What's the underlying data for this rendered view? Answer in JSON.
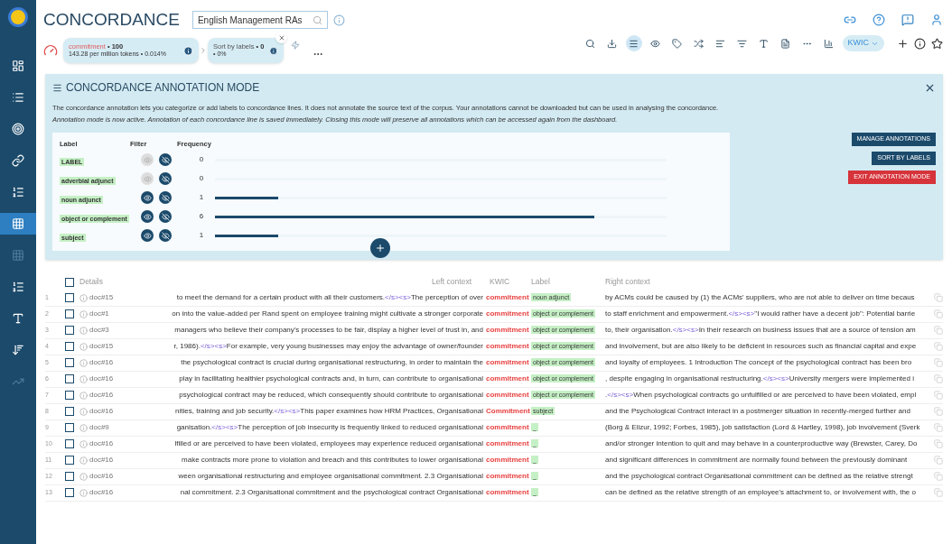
{
  "header": {
    "title": "CONCORDANCE",
    "corpus": "English Management RAs"
  },
  "select_all_checked": false,
  "chips": [
    {
      "query": "commitment",
      "count": "• 100",
      "detail": "143.28 per million tokens • 0.014%",
      "closable": false
    },
    {
      "query": "Sort by labels",
      "count": "• 0",
      "detail": "• 0%",
      "closable": true
    }
  ],
  "toolbar": [
    {
      "kind": "search",
      "selected": false
    },
    {
      "kind": "download",
      "selected": false
    },
    {
      "kind": "lines",
      "selected": true
    },
    {
      "kind": "eye",
      "selected": false
    },
    {
      "kind": "tag",
      "selected": false
    },
    {
      "kind": "shuffle",
      "selected": false
    },
    {
      "kind": "sort",
      "selected": false
    },
    {
      "kind": "filter",
      "selected": false
    },
    {
      "kind": "gdex",
      "selected": false
    },
    {
      "kind": "doc",
      "selected": false
    },
    {
      "kind": "dots",
      "selected": false
    },
    {
      "kind": "chart",
      "selected": false
    }
  ],
  "view_select": "KWIC",
  "sidebar": [
    {
      "kind": "dashboard",
      "selected": false
    },
    {
      "kind": "list",
      "selected": false
    },
    {
      "kind": "target",
      "selected": false
    },
    {
      "kind": "chain",
      "selected": false
    },
    {
      "kind": "bullets",
      "selected": false
    },
    {
      "kind": "concordance",
      "selected": true
    },
    {
      "kind": "grid",
      "selected": false
    },
    {
      "kind": "rank",
      "selected": false
    },
    {
      "kind": "ne",
      "selected": false
    },
    {
      "kind": "sort",
      "selected": false
    },
    {
      "kind": "trend",
      "selected": false
    }
  ],
  "annotation": {
    "title": "CONCORDANCE ANNOTATION MODE",
    "description": "The concordance annotation lets you categorize or add labels to concordance lines. It does not annotate the source text of the corpus. Your annotations cannot be downloaded but can be used in analysing the concordance.",
    "note": "Annotation mode is now active. Annotation of each concordance line is saved immediately. Closing this mode will preserve all annotations which can be accessed again from the dashboard.",
    "columns": [
      "Label",
      "Filter",
      "Frequency"
    ],
    "labels": [
      {
        "label": "LABEL",
        "visible_enabled": false,
        "frequency": "0"
      },
      {
        "label": "adverbial adjunct",
        "visible_enabled": false,
        "frequency": "0"
      },
      {
        "label": "noun adjunct",
        "visible_enabled": true,
        "frequency": "1",
        "level": 0.14
      },
      {
        "label": "object or complement",
        "visible_enabled": true,
        "frequency": "6",
        "level": 0.84
      },
      {
        "label": "subject",
        "visible_enabled": true,
        "frequency": "1",
        "level": 0.14
      }
    ],
    "buttons": [
      {
        "label": "MANAGE ANNOTATIONS",
        "kind": "primary"
      },
      {
        "label": "SORT BY LABELS",
        "kind": "primary"
      },
      {
        "label": "EXIT ANNOTATION MODE",
        "kind": "danger"
      }
    ]
  },
  "table": {
    "columns": [
      "Details",
      "Left context",
      "KWIC",
      "Label",
      "Right context"
    ],
    "rows": [
      {
        "num": "1",
        "checked": false,
        "doc": "doc#15",
        "left": [
          {
            "kind": "text",
            "text": "to meet the demand for a certain product with all their customers."
          },
          {
            "kind": "tag",
            "text": "</s><s>"
          },
          {
            "kind": "text",
            "text": "The perception of over"
          }
        ],
        "kwic": "commitment",
        "label": "noun adjunct",
        "right": [
          {
            "kind": "text",
            "text": "by ACMs could be caused by (1) the ACMs' suppliers, who are not able to deliver on time becaus"
          }
        ]
      },
      {
        "num": "2",
        "checked": false,
        "doc": "doc#1",
        "left": [
          {
            "kind": "text",
            "text": "on into the value-added per Rand spent on employee training might cultivate a stronger corporate"
          }
        ],
        "kwic": "commitment",
        "label": "object or complement",
        "right": [
          {
            "kind": "text",
            "text": "to staff enrichment and empowerment."
          },
          {
            "kind": "tag",
            "text": "</s><s>"
          },
          {
            "kind": "text",
            "text": "\"I would rather have a decent job\": Potential barrie"
          }
        ]
      },
      {
        "num": "3",
        "checked": false,
        "doc": "doc#3",
        "left": [
          {
            "kind": "text",
            "text": "managers who believe their company's processes to be fair, display a higher level of trust in, and"
          }
        ],
        "kwic": "commitment",
        "label": "object or complement",
        "right": [
          {
            "kind": "text",
            "text": "to, their organisation."
          },
          {
            "kind": "tag",
            "text": "</s><s>"
          },
          {
            "kind": "text",
            "text": "In their research on business issues that are a source of tension am"
          }
        ]
      },
      {
        "num": "4",
        "checked": false,
        "doc": "doc#15",
        "left": [
          {
            "kind": "text",
            "text": "r, 1986)."
          },
          {
            "kind": "tag",
            "text": "</s><s>"
          },
          {
            "kind": "text",
            "text": "For example, very young businesses may enjoy the advantage of owner/founder"
          }
        ],
        "kwic": "commitment",
        "label": "object or complement",
        "right": [
          {
            "kind": "text",
            "text": "and involvement, but are also likely to be deficient in resources such as financial capital and expe"
          }
        ]
      },
      {
        "num": "5",
        "checked": false,
        "doc": "doc#16",
        "left": [
          {
            "kind": "text",
            "text": "the psychological contract is crucial during organisational restructuring, in order to maintain the"
          }
        ],
        "kwic": "commitment",
        "label": "object or complement",
        "right": [
          {
            "kind": "text",
            "text": "and loyalty of employees. 1 Introduction The concept of the psychological contract has been bro"
          }
        ]
      },
      {
        "num": "6",
        "checked": false,
        "doc": "doc#16",
        "left": [
          {
            "kind": "text",
            "text": "play in facilitating healthier psychological contracts and, in turn, can contribute to organisational"
          }
        ],
        "kwic": "commitment",
        "label": "object or complement",
        "right": [
          {
            "kind": "text",
            "text": ", despite engaging in organisational restructuring."
          },
          {
            "kind": "tag",
            "text": "</s><s>"
          },
          {
            "kind": "text",
            "text": "University mergers were implemented i"
          }
        ]
      },
      {
        "num": "7",
        "checked": false,
        "doc": "doc#16",
        "left": [
          {
            "kind": "text",
            "text": "psychological contract may be reduced, which consequently should contribute to organisational"
          }
        ],
        "kwic": "commitment",
        "label": "object or complement",
        "right": [
          {
            "kind": "text",
            "text": "."
          },
          {
            "kind": "tag",
            "text": "</s><s>"
          },
          {
            "kind": "text",
            "text": "When psychological contracts go unfulfilled or are perceived to have been violated, empl"
          }
        ]
      },
      {
        "num": "8",
        "checked": false,
        "doc": "doc#16",
        "left": [
          {
            "kind": "text",
            "text": "nities, training and job security."
          },
          {
            "kind": "tag",
            "text": "</s><s>"
          },
          {
            "kind": "text",
            "text": "This paper examines how HRM Practices, Organisational"
          }
        ],
        "kwic": "Commitment",
        "label": "subject",
        "right": [
          {
            "kind": "text",
            "text": "and the Psychological Contract interact in a postmerger situation in recently-merged further and"
          }
        ]
      },
      {
        "num": "9",
        "checked": false,
        "doc": "doc#9",
        "left": [
          {
            "kind": "text",
            "text": "ganisation."
          },
          {
            "kind": "tag",
            "text": "</s><s>"
          },
          {
            "kind": "text",
            "text": "The perception of job insecurity is frequently linked to reduced organisational"
          }
        ],
        "kwic": "commitment",
        "label": "_",
        "right": [
          {
            "kind": "text",
            "text": "(Borg & Elizur, 1992; Forbes, 1985), job satisfaction (Lord & Hartley, 1998), job involvement (Sverk"
          }
        ]
      },
      {
        "num": "10",
        "checked": false,
        "doc": "doc#16",
        "left": [
          {
            "kind": "text",
            "text": "lfilled or are perceived to have been violated, employees may experience reduced organisational"
          }
        ],
        "kwic": "commitment",
        "label": "_",
        "right": [
          {
            "kind": "text",
            "text": "and/or stronger intention to quit and may behave in a counterproductive way (Brewster, Carey, Do"
          }
        ]
      },
      {
        "num": "11",
        "checked": false,
        "doc": "doc#16",
        "left": [
          {
            "kind": "text",
            "text": "make contracts more prone to violation and breach and this contributes to lower organisational"
          }
        ],
        "kwic": "commitment",
        "label": "_",
        "right": [
          {
            "kind": "text",
            "text": "and significant differences in commitment are normally found between the previously dominant"
          }
        ]
      },
      {
        "num": "12",
        "checked": false,
        "doc": "doc#16",
        "left": [
          {
            "kind": "text",
            "text": "ween organisational restructuring and employee organisational commitment. 2.3 Organisational"
          }
        ],
        "kwic": "commitment",
        "label": "_",
        "right": [
          {
            "kind": "text",
            "text": "and the psychological contract Organisational commitment can be defined as the relative strengt"
          }
        ]
      },
      {
        "num": "13",
        "checked": false,
        "doc": "doc#16",
        "left": [
          {
            "kind": "text",
            "text": "nal commitment. 2.3 Organisational commitment and the psychological contract Organisational"
          }
        ],
        "kwic": "commitment",
        "label": "_",
        "right": [
          {
            "kind": "text",
            "text": "can be defined as the relative strength of an employee's attachment to, or involvement with, the o"
          }
        ]
      }
    ]
  }
}
